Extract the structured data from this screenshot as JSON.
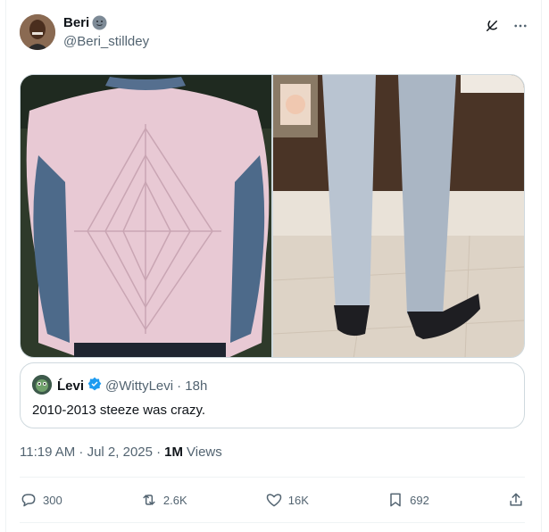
{
  "author": {
    "name": "Beri",
    "emoji_icon": "slightly-smiling-face-icon",
    "handle": "@Beri_stilldey"
  },
  "header_icons": [
    "grok-icon",
    "more-icon"
  ],
  "media": [
    {
      "description_icon": "photo-pink-shirt-back"
    },
    {
      "description_icon": "photo-grey-trousers-socks"
    }
  ],
  "quote": {
    "name": "Ĺevi",
    "verified": true,
    "handle": "@WittyLevi",
    "time": "· 18h",
    "text": "2010-2013 steeze was crazy."
  },
  "meta": {
    "time": "11:19 AM · Jul 2, 2025 ·",
    "views_count": "1M",
    "views_label": "Views"
  },
  "actions": {
    "replies": "300",
    "reposts": "2.6K",
    "likes": "16K",
    "bookmarks": "692"
  },
  "colors": {
    "text": "#0f1419",
    "secondary": "#536471",
    "border": "#cfd9de",
    "verified": "#1d9bf0"
  }
}
